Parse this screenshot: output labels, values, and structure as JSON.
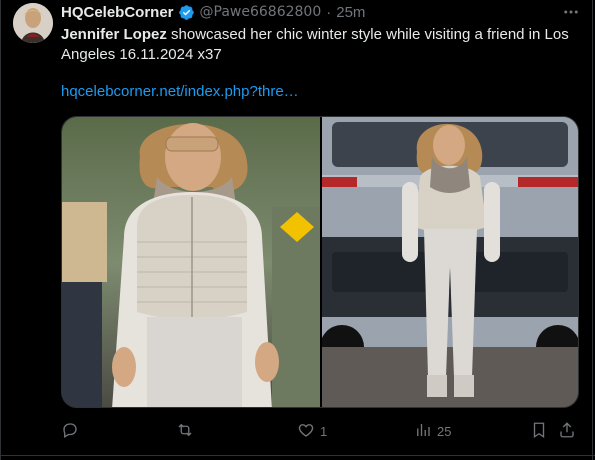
{
  "tweet": {
    "display_name": "HQCelebCorner",
    "handle": "@Pawe66862800",
    "separator": "·",
    "time": "25m",
    "text_bold": "Jennifer Lopez",
    "text_rest": " showcased her chic winter style while visiting a friend in Los Angeles 16.11.2024 x37",
    "link": "hqcelebcorner.net/index.php?thre…"
  },
  "actions": {
    "replies": "",
    "retweets": "",
    "likes": "1",
    "views": "25"
  },
  "icons": {
    "verified": "verified-badge-icon",
    "more": "more-dots-icon",
    "reply": "reply-icon",
    "retweet": "retweet-icon",
    "like": "heart-icon",
    "views": "views-bar-icon",
    "bookmark": "bookmark-icon",
    "share": "share-icon"
  },
  "colors": {
    "background": "#000000",
    "text": "#e7e9ea",
    "muted": "#71767b",
    "link": "#1d9bf0",
    "verified": "#1d9bf0"
  }
}
